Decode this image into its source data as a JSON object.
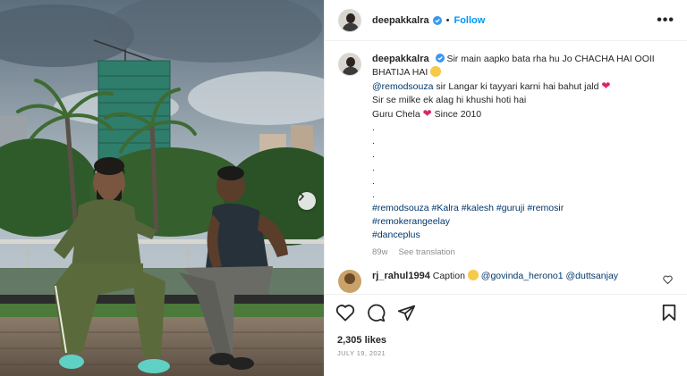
{
  "post": {
    "username": "deepakkalra",
    "follow_label": "Follow",
    "separator": "•",
    "more_label": "•••"
  },
  "caption": {
    "line1": "Sir main aapko bata rha hu Jo CHACHA HAI OOII",
    "line2": "BHATIJA HAI",
    "mention": "@remodsouza",
    "line3_rest": " sir Langar ki tayyari karni hai bahut jald",
    "line4": "Sir se milke ek alag hi khushi hoti hai",
    "line5a": "Guru Chela",
    "line5b": " Since 2010",
    "dots": [
      ".",
      ".",
      ".",
      ".",
      ".",
      "."
    ],
    "hashtags_line1": "#remodsouza #Kalra #kalesh #guruji #remosir",
    "hashtags_line2": "#remokerangeelay",
    "hashtags_line3": "#danceplus",
    "age": "89w",
    "see_translation": "See translation"
  },
  "comment": {
    "username": "rj_rahul1994",
    "text_prefix": " Caption ",
    "mentions": "@govinda_herono1 @duttsanjay"
  },
  "footer": {
    "likes": "2,305 likes",
    "date": "JULY 19, 2021"
  },
  "icons": {
    "verified": "verified-badge-icon",
    "like": "heart-icon",
    "comment": "comment-icon",
    "share": "share-icon",
    "save": "bookmark-icon",
    "carousel_next": "chevron-right-icon"
  },
  "colors": {
    "link": "#00376b",
    "follow": "#0095f6",
    "heart": "#e0245e",
    "muted": "#8e8e8e"
  }
}
